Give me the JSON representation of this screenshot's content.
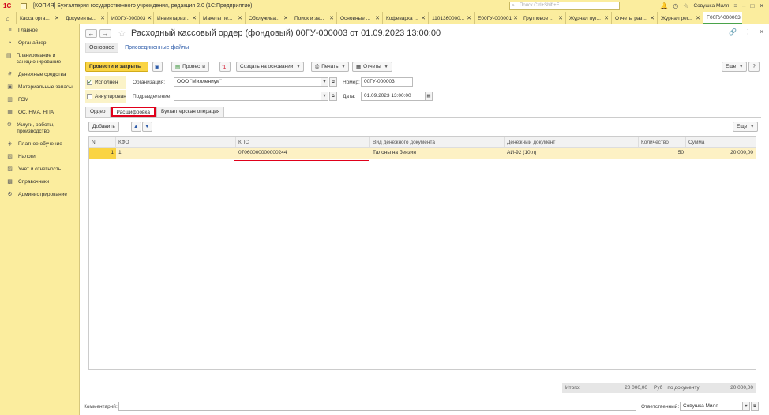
{
  "app": {
    "logo": "1С",
    "title": "[КОПИЯ] Бухгалтерия государственного учреждения, редакция 2.0  (1С:Предприятие)",
    "search_placeholder": "Поиск Ctrl+Shift+F",
    "user": "Совушка Миля"
  },
  "tabs": [
    {
      "label": "Касса орга..."
    },
    {
      "label": "Документы..."
    },
    {
      "label": "И00ГУ-000003"
    },
    {
      "label": "Инвентариз..."
    },
    {
      "label": "Макеты пе..."
    },
    {
      "label": "Обслужива..."
    },
    {
      "label": "Поиск и за..."
    },
    {
      "label": "Основные ..."
    },
    {
      "label": "Кофеварка ..."
    },
    {
      "label": "1101360000..."
    },
    {
      "label": "Е00ГУ-000001"
    },
    {
      "label": "Групповое ..."
    },
    {
      "label": "Журнал пут..."
    },
    {
      "label": "Отчеты раз..."
    },
    {
      "label": "Журнал рег..."
    },
    {
      "label": "F00ГУ-000003"
    }
  ],
  "sidebar": {
    "items": [
      {
        "label": "Главное",
        "icon": "≡"
      },
      {
        "label": "Органайзер",
        "icon": "◔"
      },
      {
        "label": "Планирование и санкционирование",
        "icon": "▤"
      },
      {
        "label": "Денежные средства",
        "icon": "₽"
      },
      {
        "label": "Материальные запасы",
        "icon": "▣"
      },
      {
        "label": "ГСМ",
        "icon": "▥"
      },
      {
        "label": "ОС, НМА, НПА",
        "icon": "▦"
      },
      {
        "label": "Услуги, работы, производство",
        "icon": "⚙"
      },
      {
        "label": "Платное обучение",
        "icon": "◈"
      },
      {
        "label": "Налоги",
        "icon": "▧"
      },
      {
        "label": "Учет и отчетность",
        "icon": "▨"
      },
      {
        "label": "Справочники",
        "icon": "▩"
      },
      {
        "label": "Администрирование",
        "icon": "⚙"
      }
    ]
  },
  "document": {
    "title": "Расходный кассовый ордер (фондовый) 00ГУ-000003 от 01.09.2023 13:00:00",
    "subtab_main": "Основное",
    "subtab_link": "Присоединенные файлы"
  },
  "toolbar": {
    "post_close": "Провести и закрыть",
    "post": "Провести",
    "create_based": "Создать на основании",
    "print": "Печать",
    "reports": "Отчеты",
    "more": "Еще",
    "help": "?"
  },
  "form": {
    "executed_label": "Исполнен",
    "executed_checked": true,
    "cancelled_label": "Аннулирован",
    "cancelled_checked": false,
    "org_label": "Организация:",
    "org_value": "ООО \"Миллениум\"",
    "number_label": "Номер:",
    "number_value": "00ГУ-000003",
    "subdivision_label": "Подразделение:",
    "subdivision_value": "",
    "date_label": "Дата:",
    "date_value": "01.09.2023 13:00:00"
  },
  "inner_tabs": [
    {
      "label": "Ордер"
    },
    {
      "label": "Расшифровка"
    },
    {
      "label": "Бухгалтерская операция"
    }
  ],
  "table_toolbar": {
    "add": "Добавить",
    "more": "Еще"
  },
  "table": {
    "columns": [
      "N",
      "КФО",
      "КПС",
      "Вид денежного документа",
      "Денежный документ",
      "Количество",
      "Сумма"
    ],
    "rows": [
      {
        "n": "1",
        "kfo": "1",
        "kps": "07060000000000244",
        "doc_type": "Талоны на бензин",
        "doc": "АИ-92 (10 л)",
        "qty": "50",
        "sum": "20 000,00"
      }
    ]
  },
  "totals": {
    "total_label": "Итого:",
    "total_value": "20 000,00",
    "currency": "Руб",
    "by_doc_label": "по документу:",
    "by_doc_value": "20 000,00"
  },
  "footer": {
    "comment_label": "Комментарий:",
    "comment_value": "",
    "responsible_label": "Ответственный:",
    "responsible_value": "Совушка Миля"
  },
  "colors": {
    "accent_yellow": "#fad443",
    "panel_yellow": "#fbed9e",
    "highlight_red": "#e0001a",
    "link_blue": "#2b5aa8"
  }
}
